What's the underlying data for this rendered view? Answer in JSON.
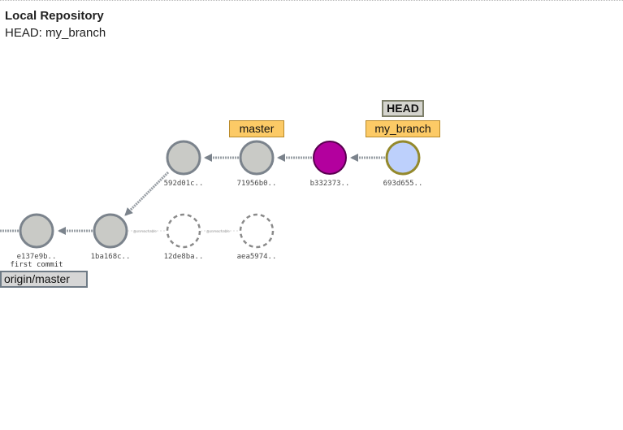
{
  "repo": {
    "title": "Local Repository",
    "head_label": "HEAD: my_branch"
  },
  "tags": {
    "head": "HEAD",
    "my_branch": "my_branch",
    "master": "master",
    "origin_master": "origin/master"
  },
  "commits": [
    {
      "id": "693d655..",
      "state": "head-commit"
    },
    {
      "id": "b332373..",
      "state": "highlighted"
    },
    {
      "id": "71956b0..",
      "state": "normal"
    },
    {
      "id": "592d01c..",
      "state": "normal"
    },
    {
      "id": "1ba168c..",
      "state": "normal"
    },
    {
      "id": "e137e9b..",
      "state": "normal",
      "message": "first commit"
    },
    {
      "id": "12de8ba..",
      "state": "unreachable"
    },
    {
      "id": "aea5974..",
      "state": "unreachable"
    }
  ],
  "unreachable_link_text": "@unreachable",
  "colors": {
    "commit_fill": "#c9cac6",
    "commit_stroke": "#7b838c",
    "highlight_fill": "#b3009e",
    "head_commit_fill": "#bdd0fc",
    "head_commit_stroke": "#94892c",
    "branch_tag": "#fcca66",
    "head_tag": "#d4d4ce",
    "remote_tag": "#d6d6d6"
  }
}
